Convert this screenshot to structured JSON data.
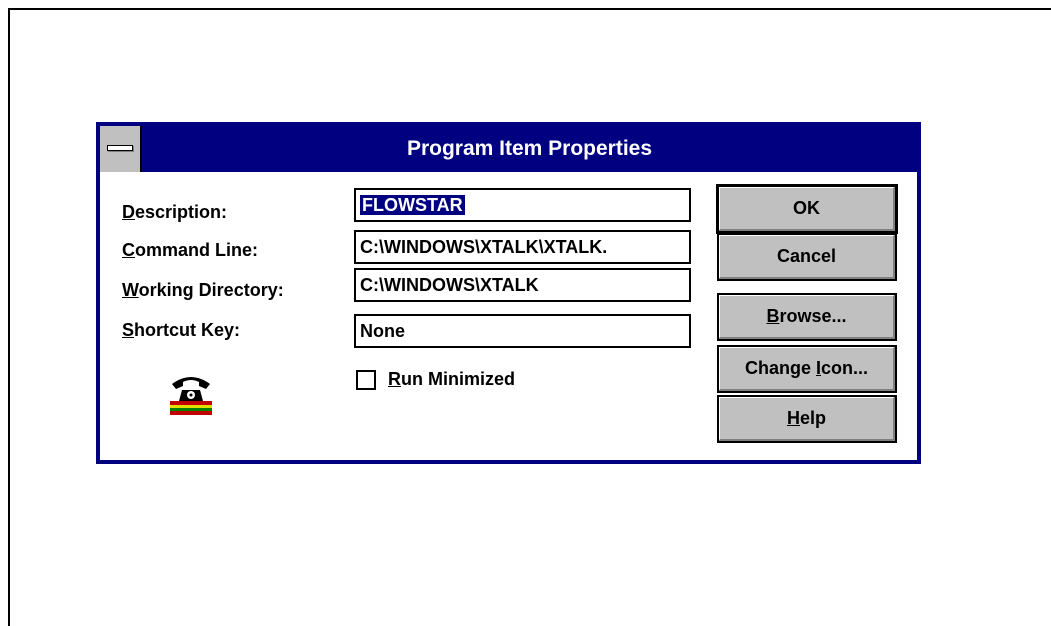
{
  "dialog": {
    "title": "Program Item Properties",
    "fields": {
      "description": {
        "label_u": "D",
        "label_rest": "escription:",
        "value": "FLOWSTAR"
      },
      "command_line": {
        "label_u": "C",
        "label_rest": "ommand Line:",
        "value": "C:\\WINDOWS\\XTALK\\XTALK."
      },
      "working_directory": {
        "label_u": "W",
        "label_rest": "orking Directory:",
        "value": "C:\\WINDOWS\\XTALK"
      },
      "shortcut_key": {
        "label_u": "S",
        "label_rest": "hortcut Key:",
        "value": "None"
      }
    },
    "run_minimized": {
      "label_u": "R",
      "label_rest": "un Minimized",
      "checked": false
    },
    "buttons": {
      "ok": "OK",
      "cancel": "Cancel",
      "browse_u": "B",
      "browse_rest": "rowse...",
      "change_icon_pre": "Change ",
      "change_icon_u": "I",
      "change_icon_rest": "con...",
      "help_u": "H",
      "help_rest": "elp"
    },
    "icon": "telephone-book-icon"
  },
  "colors": {
    "titlebar": "#000080",
    "button_face": "#c0c0c0",
    "selection": "#000080"
  }
}
